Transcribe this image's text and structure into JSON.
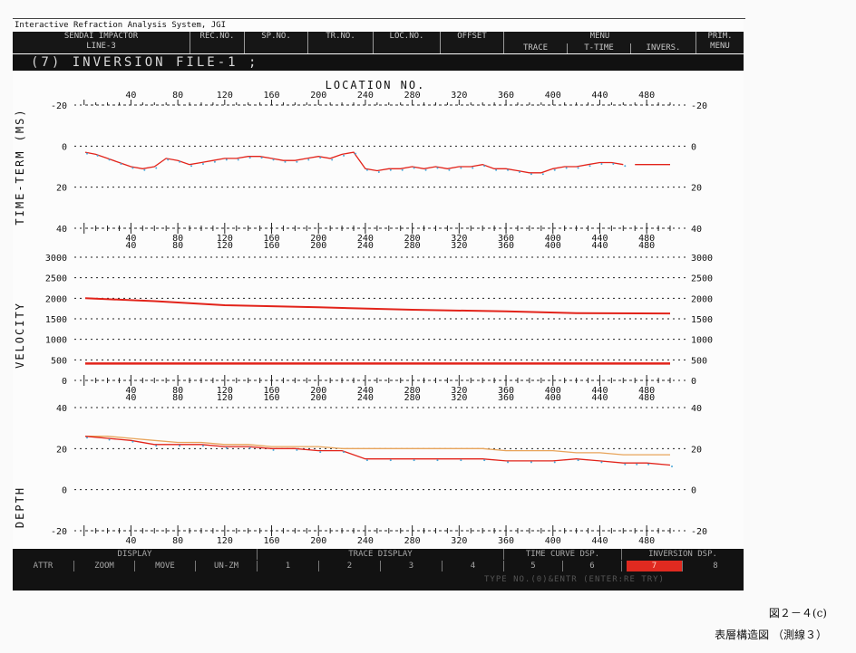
{
  "app_title": "Interactive Refraction Analysis System, JGI",
  "header": {
    "job_line1": "SENDAI IMPACTOR",
    "job_line2": "LINE-3",
    "fields": [
      "REC.NO.",
      "SP.NO.",
      "TR.NO.",
      "LOC.NO.",
      "OFFSET"
    ],
    "menu_label": "MENU",
    "menu_items": [
      "TRACE",
      "T-TIME",
      "INVERS."
    ],
    "prim_line1": "PRIM.",
    "prim_line2": "MENU"
  },
  "file_line": "(7)  INVERSION FILE-1  ;",
  "plots": {
    "x_axis_label": "LOCATION NO.",
    "x_ticks": [
      40,
      80,
      120,
      160,
      200,
      240,
      280,
      320,
      360,
      400,
      440,
      480
    ],
    "time_term": {
      "ylabel": "TIME-TERM (MS)",
      "ticks": [
        -20,
        0,
        20,
        40
      ],
      "x": [
        1,
        10,
        20,
        30,
        40,
        50,
        60,
        70,
        80,
        90,
        100,
        110,
        120,
        130,
        140,
        150,
        160,
        170,
        180,
        190,
        200,
        210,
        220,
        230,
        240,
        250,
        260,
        270,
        280,
        290,
        300,
        310,
        320,
        330,
        340,
        350,
        360,
        370,
        380,
        390,
        400,
        410,
        420,
        430,
        440,
        450,
        460,
        470,
        480,
        490,
        500
      ],
      "y": [
        3,
        4,
        6,
        8,
        10,
        11,
        10,
        6,
        7,
        9,
        8,
        7,
        6,
        6,
        5,
        5,
        6,
        7,
        7,
        6,
        5,
        6,
        4,
        3,
        11,
        12,
        11,
        11,
        10,
        11,
        10,
        11,
        10,
        10,
        9,
        11,
        11,
        12,
        13,
        13,
        11,
        10,
        10,
        9,
        8,
        8,
        9,
        9,
        9,
        9,
        9
      ]
    },
    "velocity": {
      "ylabel": "VELOCITY",
      "ticks": [
        0,
        500,
        1000,
        1500,
        2000,
        2500,
        3000
      ],
      "x": [
        1,
        60,
        120,
        200,
        280,
        360,
        420,
        500
      ],
      "upper": [
        2000,
        1930,
        1830,
        1780,
        1720,
        1680,
        1640,
        1630
      ],
      "lower": [
        410,
        410,
        410,
        410,
        410,
        410,
        410,
        410
      ]
    },
    "depth": {
      "ylabel": "DEPTH",
      "ticks": [
        -20,
        0,
        20,
        40
      ],
      "x": [
        1,
        20,
        40,
        60,
        80,
        100,
        120,
        140,
        160,
        180,
        200,
        220,
        240,
        260,
        280,
        300,
        320,
        340,
        360,
        380,
        400,
        420,
        440,
        460,
        470,
        480,
        500
      ],
      "surface": [
        26,
        26,
        25,
        24,
        23,
        23,
        22,
        22,
        21,
        21,
        21,
        20,
        20,
        20,
        20,
        20,
        20,
        20,
        19,
        19,
        19,
        18,
        18,
        17,
        17,
        17,
        17
      ],
      "boundary": [
        26,
        25,
        24,
        22,
        22,
        22,
        21,
        21,
        20,
        20,
        19,
        19,
        15,
        15,
        15,
        15,
        15,
        15,
        14,
        14,
        14,
        15,
        14,
        13,
        13,
        13,
        12
      ]
    },
    "colors": {
      "trace": "#e2231a",
      "scatter": "#4aa8d8",
      "surface": "#e8a45a",
      "axis": "#222222"
    }
  },
  "bottom": {
    "sections": [
      "DISPLAY",
      "TRACE DISPLAY",
      "TIME CURVE DSP.",
      "INVERSION DSP."
    ],
    "buttons": [
      "ATTR",
      "ZOOM",
      "MOVE",
      "UN-ZM",
      "1",
      "2",
      "3",
      "4",
      "5",
      "6",
      "7",
      "8"
    ],
    "status": "TYPE NO.(0)&ENTR  (ENTER:RE TRY)"
  },
  "caption": {
    "figure": "図２－４(c)",
    "title": "表層構造図 （測線３）"
  }
}
